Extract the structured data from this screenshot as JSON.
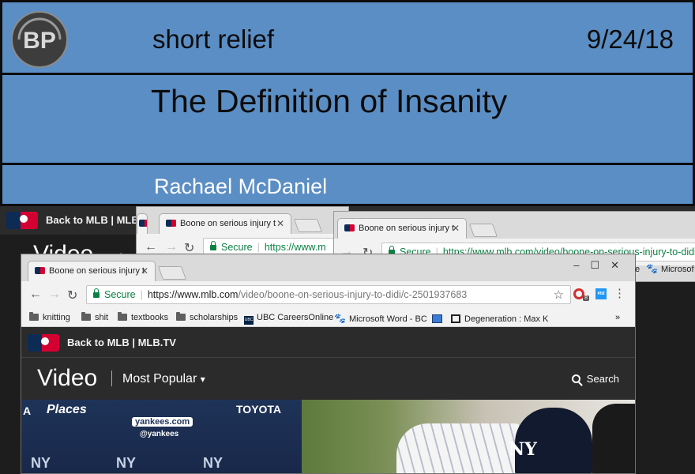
{
  "banner": {
    "logo_text": "BP",
    "category": "short relief",
    "date": "9/24/18",
    "headline": "The Definition of Insanity",
    "author": "Rachael McDaniel"
  },
  "background_page": {
    "back_link": "Back to MLB | MLB.T",
    "video_title": "Video",
    "dot": "•"
  },
  "window_a": {
    "tab_title": "Boone on serious injury t",
    "secure_label": "Secure",
    "url": "https://www.m"
  },
  "window_b": {
    "tab_title": "Boone on serious injury t",
    "secure_label": "Secure",
    "url_host": "https://www.mlb.com",
    "url_path": "/video/boone-on-serious-injury-to-didi"
  },
  "window_c": {
    "tab_title": "Boone on serious injury t",
    "secure_label": "Secure",
    "url_host": "https://www.mlb.com",
    "url_path": "/video/boone-on-serious-injury-to-didi/c-2501937683",
    "ext_badge": "8",
    "ext_blue_label": "#td",
    "bookmarks": [
      "knitting",
      "shit",
      "textbooks",
      "scholarships",
      "UBC CareersOnline",
      "Microsoft Word - BC",
      "Degeneration : Max K"
    ],
    "bookmarks_overflow": "»",
    "behind_partial": [
      "e",
      "Microsof"
    ]
  },
  "site": {
    "back_link": "Back to MLB | MLB.TV",
    "title": "Video",
    "menu": "Most Popular",
    "menu_caret": "▾",
    "search": "Search"
  },
  "video_frame": {
    "sponsors": [
      "A",
      "Places",
      "TOYOTA",
      "yankees.com",
      "@yankees",
      "NY"
    ]
  },
  "colors": {
    "banner_blue": "#5b8ec4",
    "mlb_navy": "#0c2c56",
    "mlb_red": "#d50032",
    "secure_green": "#0b8043",
    "site_dark": "#2b2b2b"
  }
}
